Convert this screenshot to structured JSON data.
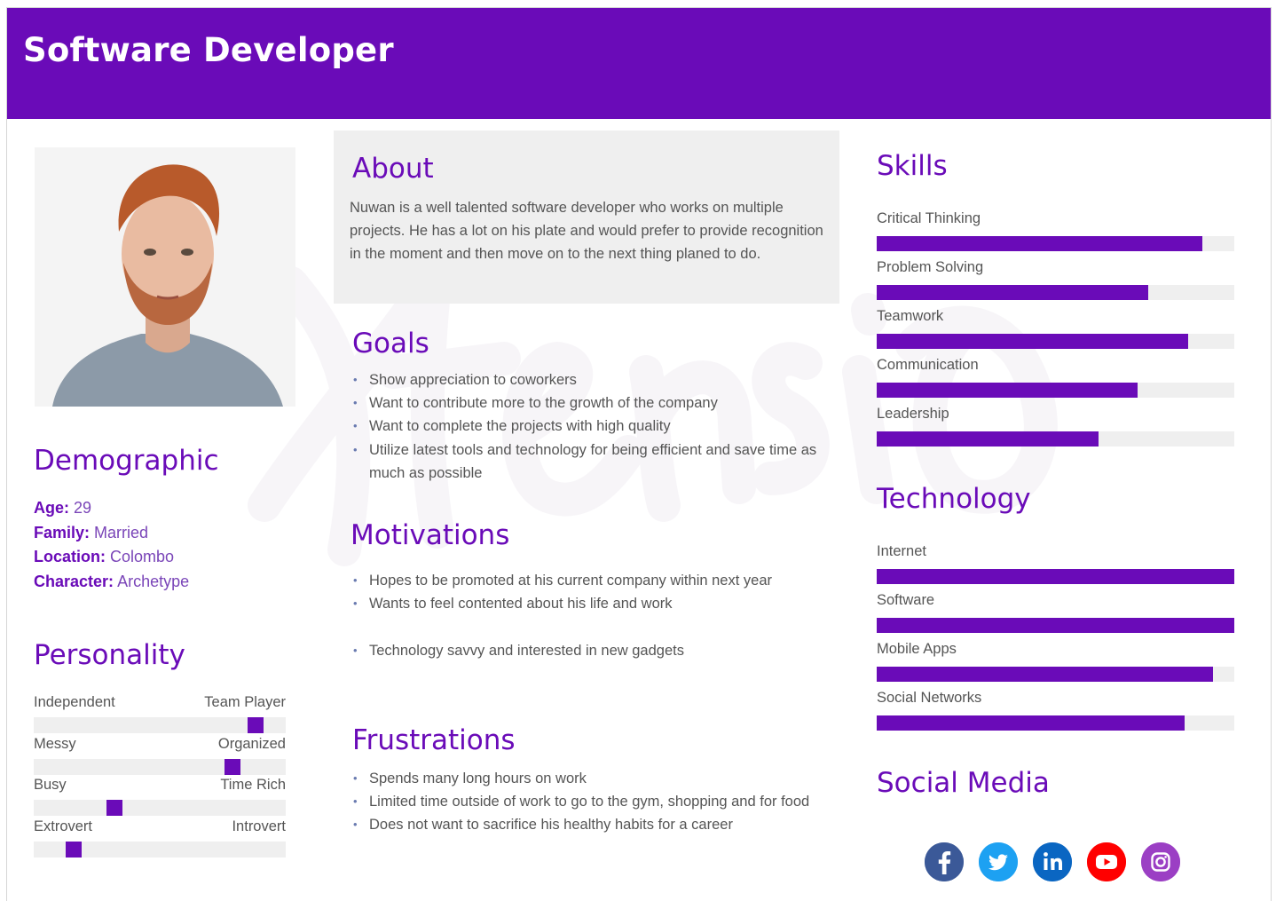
{
  "header": {
    "title": "Software Developer"
  },
  "demographic": {
    "title": "Demographic",
    "rows": [
      {
        "label": "Age:",
        "value": "29"
      },
      {
        "label": "Family:",
        "value": "Married"
      },
      {
        "label": "Location:",
        "value": "Colombo"
      },
      {
        "label": "Character:",
        "value": "Archetype"
      }
    ]
  },
  "personality": {
    "title": "Personality",
    "sliders": [
      {
        "left": "Independent",
        "right": "Team Player",
        "value": 0.88
      },
      {
        "left": "Messy",
        "right": "Organized",
        "value": 0.79
      },
      {
        "left": "Busy",
        "right": "Time Rich",
        "value": 0.32
      },
      {
        "left": "Extrovert",
        "right": "Introvert",
        "value": 0.16
      }
    ]
  },
  "about": {
    "title": "About",
    "text": "Nuwan is a well talented software developer who works on multiple projects. He has a lot on his plate and would prefer to provide recognition in the moment and then move on to the next thing planed to do."
  },
  "goals": {
    "title": "Goals",
    "items": [
      "Show appreciation to coworkers",
      "Want to contribute more to the growth of the company",
      "Want to complete the projects with high quality",
      "Utilize latest tools and technology for being efficient and save time as much as possible"
    ]
  },
  "motivations": {
    "title": "Motivations",
    "items": [
      "Hopes to be promoted at his current company within next year",
      "Wants to feel contented about his life and work",
      "Technology savvy and interested in new gadgets"
    ]
  },
  "frustrations": {
    "title": "Frustrations",
    "items": [
      "Spends many long hours on work",
      "Limited time outside of work to go to the gym, shopping and for food",
      "Does not want to sacrifice his healthy habits for a career"
    ]
  },
  "skills": {
    "title": "Skills",
    "items": [
      {
        "label": "Critical Thinking",
        "value": 0.91
      },
      {
        "label": "Problem Solving",
        "value": 0.76
      },
      {
        "label": "Teamwork",
        "value": 0.87
      },
      {
        "label": "Communication",
        "value": 0.73
      },
      {
        "label": "Leadership",
        "value": 0.62
      }
    ]
  },
  "technology": {
    "title": "Technology",
    "items": [
      {
        "label": "Internet",
        "value": 1.0
      },
      {
        "label": "Software",
        "value": 1.0
      },
      {
        "label": "Mobile Apps",
        "value": 0.94
      },
      {
        "label": "Social Networks",
        "value": 0.86
      }
    ]
  },
  "social_media": {
    "title": "Social Media",
    "icons": [
      {
        "name": "facebook-icon",
        "color": "#3b5998"
      },
      {
        "name": "twitter-icon",
        "color": "#1da1f2"
      },
      {
        "name": "linkedin-icon",
        "color": "#0a66c2"
      },
      {
        "name": "youtube-icon",
        "color": "#ff0000"
      },
      {
        "name": "instagram-icon",
        "color": "#9b3fc4"
      }
    ]
  },
  "colors": {
    "accent": "#6a0bb8",
    "track": "#efefef",
    "about_bg": "#efefef"
  }
}
